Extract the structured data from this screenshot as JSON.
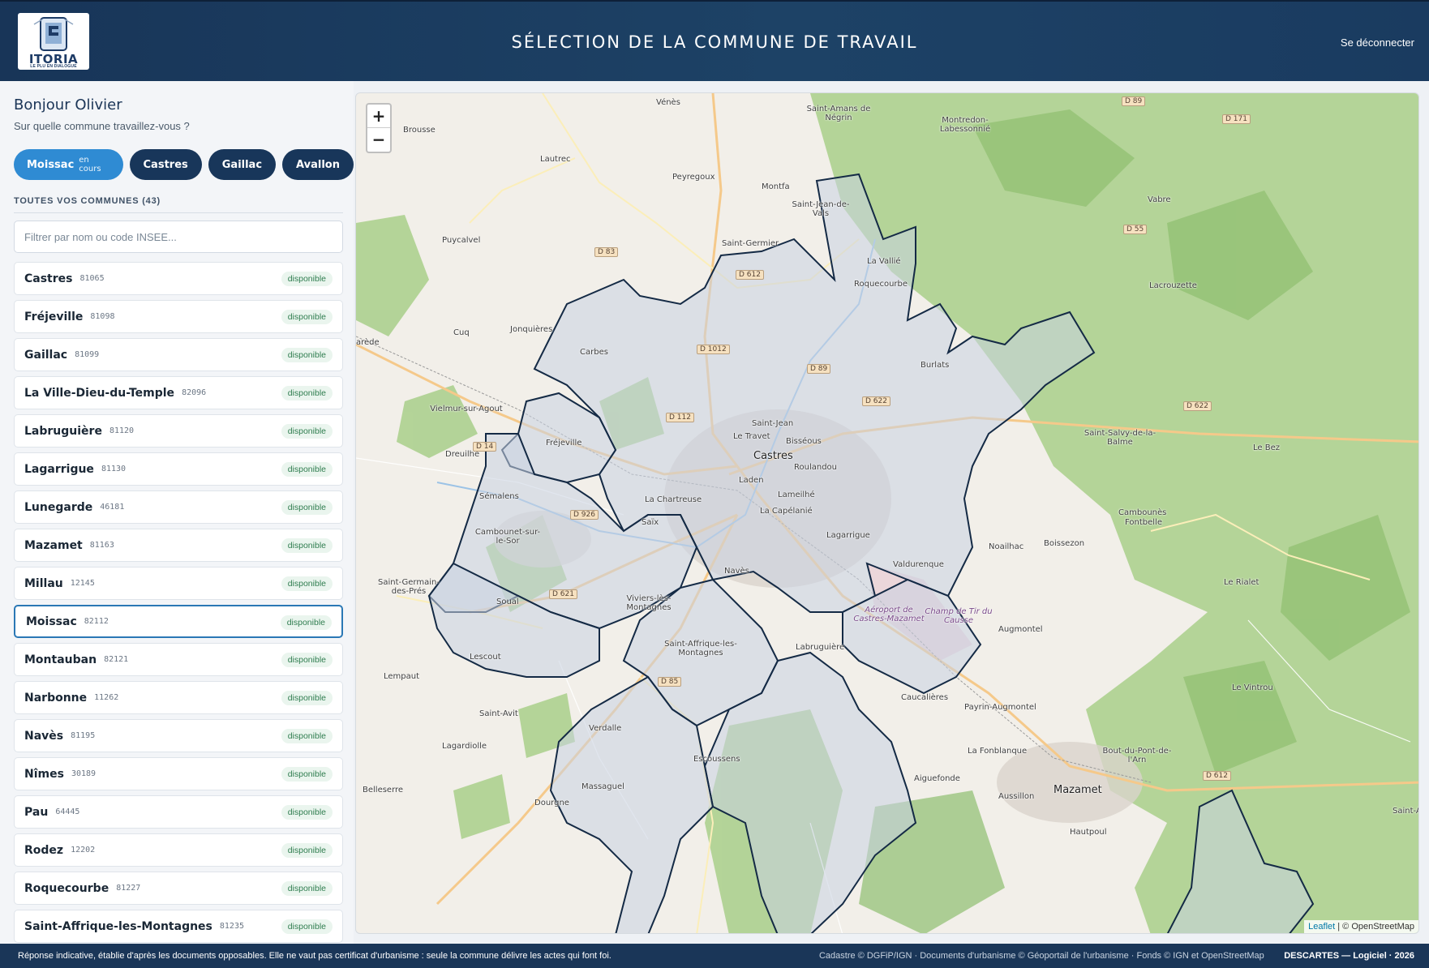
{
  "header": {
    "logo_text": "ITORIA",
    "logo_sub": "LE PLU EN DIALOGUE",
    "title": "SÉLECTION DE LA COMMUNE DE TRAVAIL",
    "logout": "Se déconnecter"
  },
  "sidebar": {
    "greeting": "Bonjour Olivier",
    "question": "Sur quelle commune travaillez-vous ?",
    "chips": [
      {
        "label": "Moissac",
        "sub": "en cours"
      },
      {
        "label": "Castres"
      },
      {
        "label": "Gaillac"
      },
      {
        "label": "Avallon"
      }
    ],
    "section_title": "TOUTES VOS COMMUNES (43)",
    "filter_placeholder": "Filtrer par nom ou code INSEE...",
    "communes": [
      {
        "name": "Castres",
        "code": "81065",
        "status": "disponible"
      },
      {
        "name": "Fréjeville",
        "code": "81098",
        "status": "disponible"
      },
      {
        "name": "Gaillac",
        "code": "81099",
        "status": "disponible"
      },
      {
        "name": "La Ville-Dieu-du-Temple",
        "code": "82096",
        "status": "disponible"
      },
      {
        "name": "Labruguière",
        "code": "81120",
        "status": "disponible"
      },
      {
        "name": "Lagarrigue",
        "code": "81130",
        "status": "disponible"
      },
      {
        "name": "Lunegarde",
        "code": "46181",
        "status": "disponible"
      },
      {
        "name": "Mazamet",
        "code": "81163",
        "status": "disponible"
      },
      {
        "name": "Millau",
        "code": "12145",
        "status": "disponible"
      },
      {
        "name": "Moissac",
        "code": "82112",
        "status": "disponible"
      },
      {
        "name": "Montauban",
        "code": "82121",
        "status": "disponible"
      },
      {
        "name": "Narbonne",
        "code": "11262",
        "status": "disponible"
      },
      {
        "name": "Navès",
        "code": "81195",
        "status": "disponible"
      },
      {
        "name": "Nîmes",
        "code": "30189",
        "status": "disponible"
      },
      {
        "name": "Pau",
        "code": "64445",
        "status": "disponible"
      },
      {
        "name": "Rodez",
        "code": "12202",
        "status": "disponible"
      },
      {
        "name": "Roquecourbe",
        "code": "81227",
        "status": "disponible"
      },
      {
        "name": "Saint-Affrique-les-Montagnes",
        "code": "81235",
        "status": "disponible"
      }
    ]
  },
  "map": {
    "zoom_in": "+",
    "zoom_out": "−",
    "attribution_leaflet": "Leaflet",
    "attribution_rest": "| © OpenStreetMap",
    "places": [
      {
        "label": "Vénès"
      },
      {
        "label": "Saint-Amans de Négrin"
      },
      {
        "label": "Montredon-Labessonnié"
      },
      {
        "label": "Brousse"
      },
      {
        "label": "Lautrec"
      },
      {
        "label": "Peyregoux"
      },
      {
        "label": "Montfa"
      },
      {
        "label": "Saint-Jean-de-Vals"
      },
      {
        "label": "Vabre"
      },
      {
        "label": "Puycalvel"
      },
      {
        "label": "Saint-Germier"
      },
      {
        "label": "La Vallié"
      },
      {
        "label": "Roquecourbe"
      },
      {
        "label": "Lacrouzette"
      },
      {
        "label": "Jonquières"
      },
      {
        "label": "Cuq"
      },
      {
        "label": "Carbes"
      },
      {
        "label": "Burlats"
      },
      {
        "label": "Vielmur-sur-Agout"
      },
      {
        "label": "Saint-Jean"
      },
      {
        "label": "Le Travet"
      },
      {
        "label": "Bisséous"
      },
      {
        "label": "Castres"
      },
      {
        "label": "Roulandou"
      },
      {
        "label": "Saint-Salvy-de-la-Balme"
      },
      {
        "label": "Le Bez"
      },
      {
        "label": "Fréjeville"
      },
      {
        "label": "Dreuilhe"
      },
      {
        "label": "Sémalens"
      },
      {
        "label": "Laden"
      },
      {
        "label": "La Chartreuse"
      },
      {
        "label": "Lameilhé"
      },
      {
        "label": "Fontbelle"
      },
      {
        "label": "Saïx"
      },
      {
        "label": "La Capélanié"
      },
      {
        "label": "Cambounet-sur-le-Sor"
      },
      {
        "label": "Lagarrigue"
      },
      {
        "label": "Noailhac"
      },
      {
        "label": "Boissezon"
      },
      {
        "label": "Cambounès"
      },
      {
        "label": "Valdurenque"
      },
      {
        "label": "Navès"
      },
      {
        "label": "Saint-Germain-des-Prés"
      },
      {
        "label": "Le Rialet"
      },
      {
        "label": "Soual"
      },
      {
        "label": "Viviers-lès-Montagnes"
      },
      {
        "label": "Aéroport de Castres-Mazamet"
      },
      {
        "label": "Champ de Tir du Causse"
      },
      {
        "label": "Augmontel"
      },
      {
        "label": "Saint-Affrique-les-Montagnes"
      },
      {
        "label": "Labruguière"
      },
      {
        "label": "Lescout"
      },
      {
        "label": "Lempaut"
      },
      {
        "label": "Le Vintrou"
      },
      {
        "label": "Caucalières"
      },
      {
        "label": "Payrin-Augmontel"
      },
      {
        "label": "Saint-Avit"
      },
      {
        "label": "Verdalle"
      },
      {
        "label": "Lagardiolle"
      },
      {
        "label": "Bout-du-Pont-de-l'Arn"
      },
      {
        "label": "La Fonblanque"
      },
      {
        "label": "Escoussens"
      },
      {
        "label": "Aiguefonde"
      },
      {
        "label": "Belleserre"
      },
      {
        "label": "Massaguel"
      },
      {
        "label": "Aussillon"
      },
      {
        "label": "Mazamet"
      },
      {
        "label": "Dourgne"
      },
      {
        "label": "Hautpoul"
      },
      {
        "label": "Saint-Am Valto"
      },
      {
        "label": "arède"
      }
    ],
    "roads": [
      {
        "label": "D 89"
      },
      {
        "label": "D 171"
      },
      {
        "label": "D 83"
      },
      {
        "label": "D 612"
      },
      {
        "label": "D 55"
      },
      {
        "label": "D 1012"
      },
      {
        "label": "D 89"
      },
      {
        "label": "D 622"
      },
      {
        "label": "D 622"
      },
      {
        "label": "D 112"
      },
      {
        "label": "D 14"
      },
      {
        "label": "D 926"
      },
      {
        "label": "D 621"
      },
      {
        "label": "D 85"
      },
      {
        "label": "D 612"
      }
    ]
  },
  "footer": {
    "disclaimer": "Réponse indicative, établie d'après les documents opposables. Elle ne vaut pas certificat d'urbanisme : seule la commune délivre les actes qui font foi.",
    "credits": "Cadastre © DGFiP/IGN · Documents d'urbanisme © Géoportail de l'urbanisme · Fonds © IGN et OpenStreetMap",
    "brand": "DESCARTES — Logiciel · 2026"
  },
  "colors": {
    "header_bg": "#1b3b5f",
    "chip_active": "#2f8bd3",
    "chip": "#18365a",
    "selected_border": "#2a78b5",
    "badge_text": "#2f7d4f",
    "commune_outline": "#142a45"
  }
}
